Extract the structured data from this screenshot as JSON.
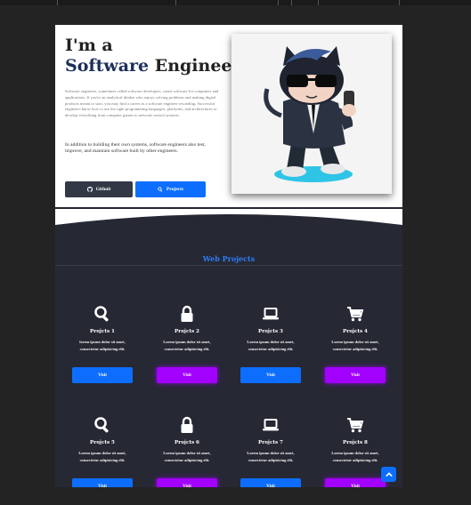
{
  "hero": {
    "line1": "I'm a",
    "accent": "Software",
    "rest": " Engineer",
    "paragraph1": "Software engineers, sometimes called software developers, create software for computers and applications. If you're an analytical thinker who enjoys solving problems and making digital products meant to start, you may find a career as a software engineer rewarding. Successful engineers know how to use the right programming languages, platforms, and architectures to develop everything from computer games to network control systems.",
    "paragraph2": "In addition to building their own systems, software engineers also test, improve, and maintain software built by other engineers.",
    "github_label": "Github",
    "projects_label": "Projects"
  },
  "projects": {
    "title": "Web Projects",
    "cards": [
      {
        "title": "Projcts 1",
        "text": "lorem ipsum dolor sit amet, consectetur adipisicing elit.",
        "button": "Visit",
        "icon": "search-icon",
        "button_color": "#0d6efd"
      },
      {
        "title": "Projcts 2",
        "text": "Lorem ipsum dolor sit amet, consectetur adipisicing elit.",
        "button": "Visit",
        "icon": "lock-icon",
        "button_color": "#a200ff"
      },
      {
        "title": "Projcts 3",
        "text": "Lorem ipsum dolor sit amet, consectetur adipisicing elit.",
        "button": "Visit",
        "icon": "laptop-icon",
        "button_color": "#0d6efd"
      },
      {
        "title": "Projcts 4",
        "text": "Lorem ipsum dolor sit amet, consectetur adipisicing elit.",
        "button": "Visit",
        "icon": "cart-icon",
        "button_color": "#a200ff"
      },
      {
        "title": "Projcts 5",
        "text": "Lorem ipsum dolor sit amet, consectetur adipisicing elit.",
        "button": "Visit",
        "icon": "search-icon",
        "button_color": "#0d6efd"
      },
      {
        "title": "Projcts 6",
        "text": "Lorem ipsum dolor sit amet, consectetur adipisicing elit.",
        "button": "Visit",
        "icon": "lock-icon",
        "button_color": "#a200ff"
      },
      {
        "title": "Projcts 7",
        "text": "Lorem ipsum dolor sit amet, consectetur adipisicing elit.",
        "button": "Visit",
        "icon": "laptop-icon",
        "button_color": "#0d6efd"
      },
      {
        "title": "Projcts 8",
        "text": "Lorem ipsum dolor sit amet, consectetur adipisicing elit.",
        "button": "Visit",
        "icon": "cart-icon",
        "button_color": "#a200ff"
      }
    ]
  },
  "colors": {
    "accent": "#1b2f5a",
    "primary": "#0d6efd",
    "purple": "#a200ff",
    "dark": "#262834"
  },
  "icons": {
    "github": "github-icon",
    "projects": "search-icon",
    "scroll_top": "chevron-up-icon"
  }
}
